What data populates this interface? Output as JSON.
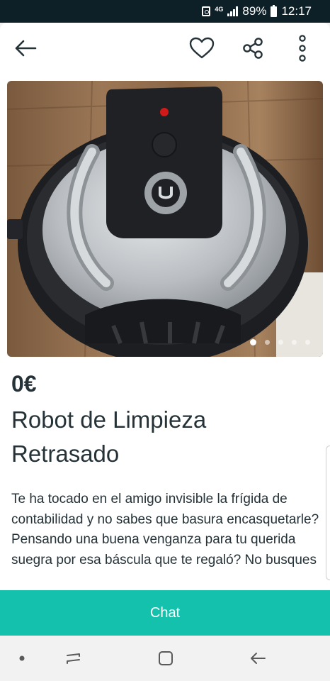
{
  "status_bar": {
    "network": "4G",
    "battery": "89%",
    "time": "12:17"
  },
  "toolbar": {
    "back_icon": "arrow-left-icon",
    "favorite_icon": "heart-icon",
    "share_icon": "share-icon",
    "more_icon": "more-vertical-icon"
  },
  "gallery": {
    "image_count": 5,
    "active_index": 0
  },
  "listing": {
    "price": "0€",
    "title": "Robot de Limpieza Retrasado",
    "description": "Te ha tocado en el amigo invisible la frígida de contabilidad y no sabes que basura encasquetarle? Pensando una buena venganza para tu querida suegra por esa báscula que te regaló? No busques"
  },
  "actions": {
    "chat_label": "Chat"
  },
  "colors": {
    "accent": "#13c1ac",
    "text": "#253238",
    "status_bar": "#0d2028"
  }
}
